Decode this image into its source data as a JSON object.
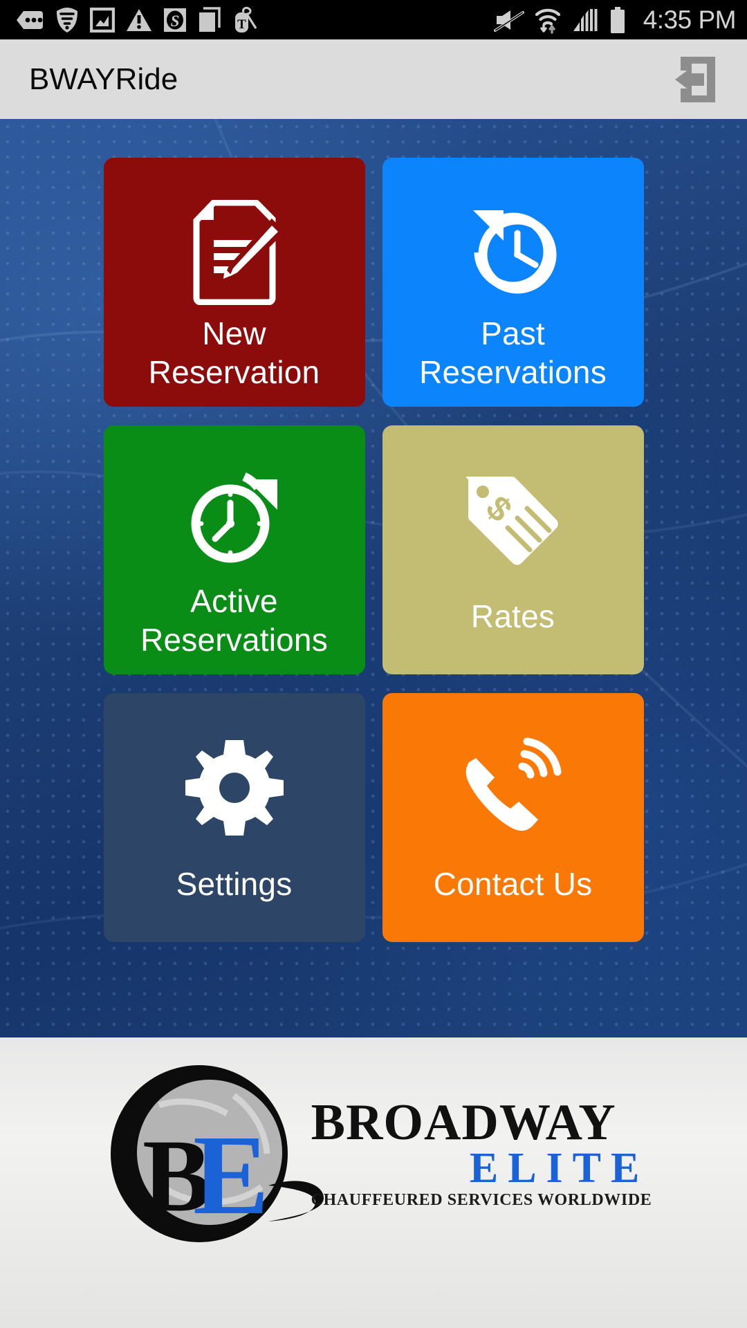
{
  "status_bar": {
    "time": "4:35 PM",
    "left_icons": [
      {
        "name": "messages-icon",
        "label": "messages"
      },
      {
        "name": "shield-signal-icon",
        "label": "shield"
      },
      {
        "name": "photo-icon",
        "label": "photo"
      },
      {
        "name": "warning-triangle-icon",
        "label": "warning"
      },
      {
        "name": "s-badge-icon",
        "label": "S app"
      },
      {
        "name": "copy-document-icon",
        "label": "document"
      },
      {
        "name": "tmobile-tag-icon",
        "label": "T-Mobile"
      }
    ],
    "right_icons": [
      {
        "name": "mute-icon",
        "label": "muted"
      },
      {
        "name": "wifi-data-icon",
        "label": "wifi"
      },
      {
        "name": "cell-signal-icon",
        "label": "signal"
      },
      {
        "name": "battery-icon",
        "label": "battery"
      }
    ]
  },
  "app_bar": {
    "title": "BWAYRide",
    "action_icon": "login-exit-icon"
  },
  "menu": {
    "tiles": [
      {
        "id": "new-reservation",
        "label": "New\nReservation",
        "icon": "document-pencil-icon",
        "color": "#8c0c0c"
      },
      {
        "id": "past-reservations",
        "label": "Past\nReservations",
        "icon": "clock-back-icon",
        "color": "#0b84fc"
      },
      {
        "id": "active-reservations",
        "label": "Active\nReservations",
        "icon": "clock-forward-icon",
        "color": "#0a8d16"
      },
      {
        "id": "rates",
        "label": "Rates",
        "icon": "price-tag-icon",
        "color": "#c2bd72"
      },
      {
        "id": "settings",
        "label": "Settings",
        "icon": "gear-icon",
        "color": "#2d4566"
      },
      {
        "id": "contact-us",
        "label": "Contact Us",
        "icon": "phone-ringing-icon",
        "color": "#f97806"
      }
    ]
  },
  "footer": {
    "brand_primary": "BROADWAY",
    "brand_secondary": "ELITE",
    "tagline": "CHAUFFEURED SERVICES WORLDWIDE",
    "monogram_b": "B",
    "monogram_e": "E",
    "brand_color": "#1a62d6"
  }
}
